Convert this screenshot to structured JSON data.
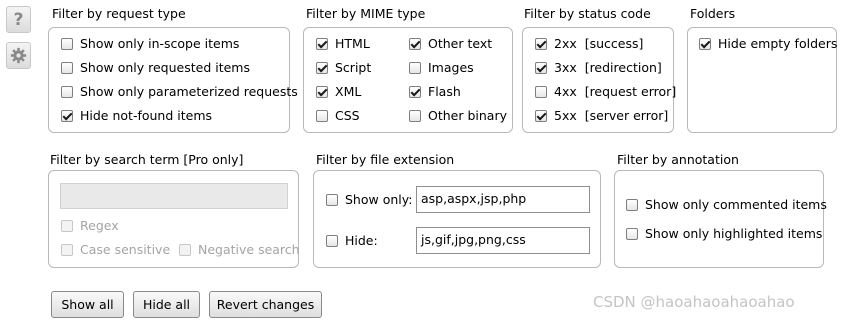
{
  "sidebar": {
    "help_glyph": "?",
    "help_icon": "question-mark-icon",
    "settings_icon": "gear-icon"
  },
  "request_type": {
    "title": "Filter by request type",
    "items": [
      {
        "label": "Show only in-scope items",
        "checked": false
      },
      {
        "label": "Show only requested items",
        "checked": false
      },
      {
        "label": "Show only parameterized requests",
        "checked": false
      },
      {
        "label": "Hide not-found items",
        "checked": true
      }
    ]
  },
  "mime_type": {
    "title": "Filter by MIME type",
    "left": [
      {
        "label": "HTML",
        "checked": true
      },
      {
        "label": "Script",
        "checked": true
      },
      {
        "label": "XML",
        "checked": true
      },
      {
        "label": "CSS",
        "checked": false
      }
    ],
    "right": [
      {
        "label": "Other text",
        "checked": true
      },
      {
        "label": "Images",
        "checked": false
      },
      {
        "label": "Flash",
        "checked": true
      },
      {
        "label": "Other binary",
        "checked": false
      }
    ]
  },
  "status_code": {
    "title": "Filter by status code",
    "items": [
      {
        "label": "2xx  [success]",
        "checked": true
      },
      {
        "label": "3xx  [redirection]",
        "checked": true
      },
      {
        "label": "4xx  [request error]",
        "checked": false
      },
      {
        "label": "5xx  [server error]",
        "checked": true
      }
    ]
  },
  "folders": {
    "title": "Folders",
    "items": [
      {
        "label": "Hide empty folders",
        "checked": true
      }
    ]
  },
  "search_term": {
    "title": "Filter by search term [Pro only]",
    "input_value": "",
    "regex_label": "Regex",
    "case_label": "Case sensitive",
    "negative_label": "Negative search"
  },
  "file_extension": {
    "title": "Filter by file extension",
    "show_only_label": "Show only:",
    "show_only_checked": false,
    "show_only_value": "asp,aspx,jsp,php",
    "hide_label": "Hide:",
    "hide_checked": false,
    "hide_value": "js,gif,jpg,png,css"
  },
  "annotation": {
    "title": "Filter by annotation",
    "items": [
      {
        "label": "Show only commented items",
        "checked": false
      },
      {
        "label": "Show only highlighted items",
        "checked": false
      }
    ]
  },
  "buttons": {
    "show_all": "Show all",
    "hide_all": "Hide all",
    "revert": "Revert changes"
  },
  "watermark": "CSDN @haoahaoahaoahao"
}
